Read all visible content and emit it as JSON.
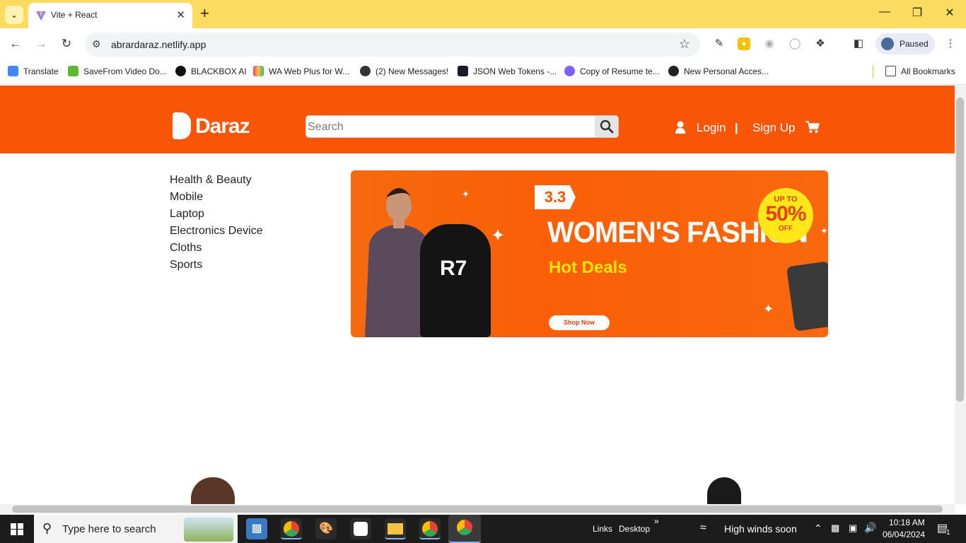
{
  "browser": {
    "tab_title": "Vite + React",
    "url": "abrardaraz.netlify.app",
    "profile_label": "Paused",
    "all_bookmarks": "All Bookmarks",
    "bookmarks": [
      {
        "label": "Translate",
        "color": "#4285f4"
      },
      {
        "label": "SaveFrom Video Do...",
        "color": "#5fb832"
      },
      {
        "label": "BLACKBOX AI",
        "color": "#111111"
      },
      {
        "label": "WA Web Plus for W...",
        "color": "#e6496b"
      },
      {
        "label": "(2) New Messages!",
        "color": "#333333"
      },
      {
        "label": "JSON Web Tokens -...",
        "color": "#1a1a2e"
      },
      {
        "label": "Copy of Resume te...",
        "color": "#7b61ff"
      },
      {
        "label": "New Personal Acces...",
        "color": "#222222"
      }
    ]
  },
  "site": {
    "brand": "Daraz",
    "accent_color": "#f85606",
    "search_placeholder": "Search",
    "login_label": "Login",
    "separator": "|",
    "signup_label": "Sign Up",
    "categories": [
      "Health & Beauty",
      "Mobile",
      "Laptop",
      "Electronics Device",
      "Cloths",
      "Sports"
    ],
    "banner": {
      "badge": "3.3",
      "title": "WOMEN'S FASHION",
      "subtitle": "Hot Deals",
      "offer_top": "UP TO",
      "offer_percent": "50%",
      "offer_bottom": "OFF",
      "button": "Shop Now",
      "hoodie_text": "R7"
    }
  },
  "taskbar": {
    "search_placeholder": "Type here to search",
    "links_label": "Links",
    "desktop_label": "Desktop",
    "weather": "High winds soon",
    "time": "10:18 AM",
    "date": "06/04/2024",
    "notification_count": "1"
  }
}
